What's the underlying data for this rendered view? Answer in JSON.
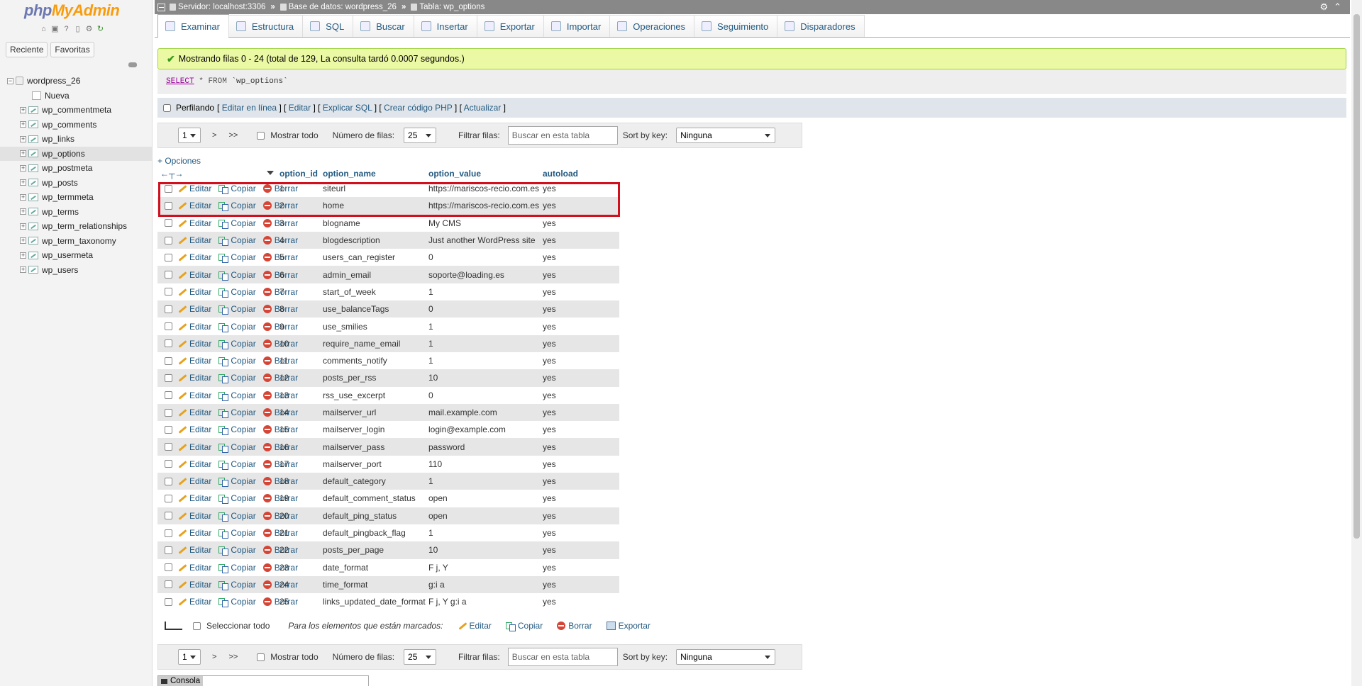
{
  "nav": {
    "logo_php": "php",
    "logo_my": "MyAdmin",
    "icons": [
      "home-icon",
      "logout-icon",
      "help-icon",
      "docs-icon",
      "settings-icon",
      "reload-icon"
    ],
    "tab_recent": "Reciente",
    "tab_favorites": "Favoritas",
    "database": "wordpress_26",
    "new_label": "Nueva",
    "tables": [
      "wp_commentmeta",
      "wp_comments",
      "wp_links",
      "wp_options",
      "wp_postmeta",
      "wp_posts",
      "wp_termmeta",
      "wp_terms",
      "wp_term_relationships",
      "wp_term_taxonomy",
      "wp_usermeta",
      "wp_users"
    ],
    "active_table": "wp_options"
  },
  "breadcrumb": {
    "server": "Servidor: localhost:3306",
    "database": "Base de datos: wordpress_26",
    "table": "Tabla: wp_options"
  },
  "tabs": [
    "Examinar",
    "Estructura",
    "SQL",
    "Buscar",
    "Insertar",
    "Exportar",
    "Importar",
    "Operaciones",
    "Seguimiento",
    "Disparadores"
  ],
  "active_tab": "Examinar",
  "success_message": "Mostrando filas 0 - 24 (total de 129, La consulta tardó 0.0007 segundos.)",
  "sql": {
    "select": "SELECT",
    "star": "*",
    "from": "FROM",
    "table": "`wp_options`"
  },
  "profiling": {
    "label": "Perfilando",
    "links": [
      "Editar en línea",
      "Editar",
      "Explicar SQL",
      "Crear código PHP",
      "Actualizar"
    ]
  },
  "navbar": {
    "page": "1",
    "next": ">",
    "last": ">>",
    "show_all": "Mostrar todo",
    "rows_label": "Número de filas:",
    "rows_value": "25",
    "filter_label": "Filtrar filas:",
    "filter_placeholder": "Buscar en esta tabla",
    "sort_label": "Sort by key:",
    "sort_value": "Ninguna"
  },
  "options_link": "+ Opciones",
  "table": {
    "columns": [
      "option_id",
      "option_name",
      "option_value",
      "autoload"
    ],
    "action_edit": "Editar",
    "action_copy": "Copiar",
    "action_delete": "Borrar",
    "rows": [
      [
        "1",
        "siteurl",
        "https://mariscos-recio.com.es",
        "yes"
      ],
      [
        "2",
        "home",
        "https://mariscos-recio.com.es",
        "yes"
      ],
      [
        "3",
        "blogname",
        "My CMS",
        "yes"
      ],
      [
        "4",
        "blogdescription",
        "Just another WordPress site",
        "yes"
      ],
      [
        "5",
        "users_can_register",
        "0",
        "yes"
      ],
      [
        "6",
        "admin_email",
        "soporte@loading.es",
        "yes"
      ],
      [
        "7",
        "start_of_week",
        "1",
        "yes"
      ],
      [
        "8",
        "use_balanceTags",
        "0",
        "yes"
      ],
      [
        "9",
        "use_smilies",
        "1",
        "yes"
      ],
      [
        "10",
        "require_name_email",
        "1",
        "yes"
      ],
      [
        "11",
        "comments_notify",
        "1",
        "yes"
      ],
      [
        "12",
        "posts_per_rss",
        "10",
        "yes"
      ],
      [
        "13",
        "rss_use_excerpt",
        "0",
        "yes"
      ],
      [
        "14",
        "mailserver_url",
        "mail.example.com",
        "yes"
      ],
      [
        "15",
        "mailserver_login",
        "login@example.com",
        "yes"
      ],
      [
        "16",
        "mailserver_pass",
        "password",
        "yes"
      ],
      [
        "17",
        "mailserver_port",
        "110",
        "yes"
      ],
      [
        "18",
        "default_category",
        "1",
        "yes"
      ],
      [
        "19",
        "default_comment_status",
        "open",
        "yes"
      ],
      [
        "20",
        "default_ping_status",
        "open",
        "yes"
      ],
      [
        "21",
        "default_pingback_flag",
        "1",
        "yes"
      ],
      [
        "22",
        "posts_per_page",
        "10",
        "yes"
      ],
      [
        "23",
        "date_format",
        "F j, Y",
        "yes"
      ],
      [
        "24",
        "time_format",
        "g:i a",
        "yes"
      ],
      [
        "25",
        "links_updated_date_format",
        "F j, Y g:i a",
        "yes"
      ]
    ]
  },
  "bulk": {
    "select_all": "Seleccionar todo",
    "marked_label": "Para los elementos que están marcados:",
    "edit": "Editar",
    "copy": "Copiar",
    "delete": "Borrar",
    "export": "Exportar"
  },
  "console_label": "Consola",
  "colors": {
    "accent": "#235a81",
    "success_bg": "#ebf8a4",
    "highlight": "#d0101d"
  }
}
